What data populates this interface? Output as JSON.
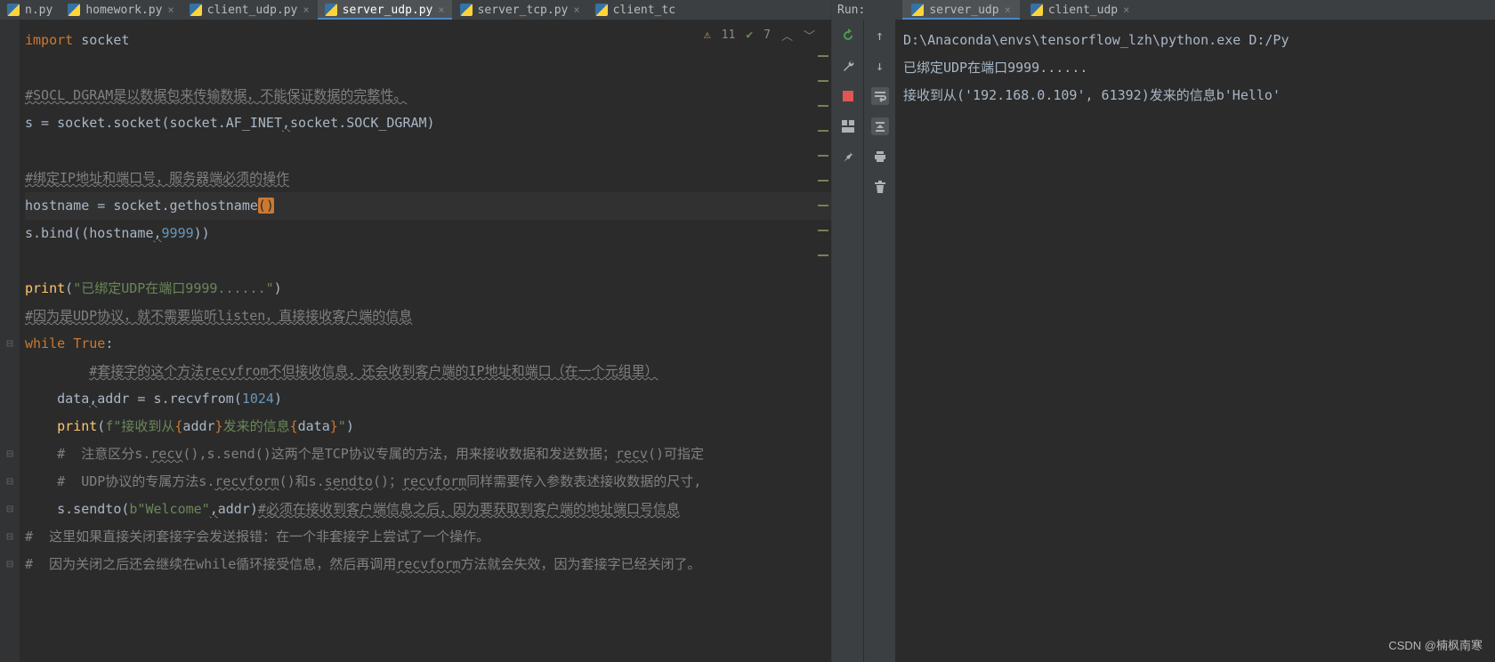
{
  "editor_tabs": [
    {
      "label": "n.py",
      "active": false,
      "partial": true
    },
    {
      "label": "homework.py",
      "active": false
    },
    {
      "label": "client_udp.py",
      "active": false
    },
    {
      "label": "server_udp.py",
      "active": true
    },
    {
      "label": "server_tcp.py",
      "active": false
    },
    {
      "label": "client_tc",
      "active": false,
      "partial": true
    }
  ],
  "status": {
    "warn_count": "11",
    "typo_count": "7"
  },
  "code_lines": [
    {
      "type": "plain",
      "tokens": [
        {
          "t": "import ",
          "c": "kw"
        },
        {
          "t": "socket",
          "c": ""
        }
      ]
    },
    {
      "type": "blank"
    },
    {
      "type": "cmt-wavy",
      "text": "#SOCL_DGRAM是以数据包来传输数据，不能保证数据的完整性。"
    },
    {
      "type": "plain",
      "tokens": [
        {
          "t": "s = socket.socket(socket.AF_INET",
          "c": ""
        },
        {
          "t": ",",
          "c": "wavy"
        },
        {
          "t": "socket.SOCK_DGRAM)",
          "c": ""
        }
      ]
    },
    {
      "type": "blank"
    },
    {
      "type": "cmt-wavy",
      "text": "#绑定IP地址和端口号，服务器端必须的操作"
    },
    {
      "type": "plain",
      "caret": true,
      "tokens": [
        {
          "t": "hostname = socket.gethostname",
          "c": ""
        },
        {
          "t": "()",
          "c": "fn-paren"
        }
      ]
    },
    {
      "type": "plain",
      "tokens": [
        {
          "t": "s.bind((hostname",
          "c": ""
        },
        {
          "t": ",",
          "c": "wavy"
        },
        {
          "t": "9999",
          "c": "num"
        },
        {
          "t": "))",
          "c": ""
        }
      ]
    },
    {
      "type": "blank"
    },
    {
      "type": "plain",
      "tokens": [
        {
          "t": "print",
          "c": "fn"
        },
        {
          "t": "(",
          "c": ""
        },
        {
          "t": "\"已绑定UDP在端口9999......\"",
          "c": "str"
        },
        {
          "t": ")",
          "c": ""
        }
      ]
    },
    {
      "type": "cmt-wavy",
      "text": "#因为是UDP协议，就不需要监听listen，直接接收客户端的信息"
    },
    {
      "type": "plain",
      "tokens": [
        {
          "t": "while ",
          "c": "kw"
        },
        {
          "t": "True",
          "c": "kw"
        },
        {
          "t": ":",
          "c": ""
        }
      ]
    },
    {
      "type": "cmt-wavy",
      "indent": 2,
      "text": "#套接字的这个方法recvfrom不但接收信息，还会收到客户端的IP地址和端口（在一个元组里）"
    },
    {
      "type": "plain",
      "indent": 1,
      "tokens": [
        {
          "t": "data",
          "c": ""
        },
        {
          "t": ",",
          "c": "wavy"
        },
        {
          "t": "addr = s.recvfrom(",
          "c": ""
        },
        {
          "t": "1024",
          "c": "num"
        },
        {
          "t": ")",
          "c": ""
        }
      ]
    },
    {
      "type": "plain",
      "indent": 1,
      "tokens": [
        {
          "t": "print",
          "c": "fn"
        },
        {
          "t": "(",
          "c": ""
        },
        {
          "t": "f\"",
          "c": "str"
        },
        {
          "t": "接收到从",
          "c": "str"
        },
        {
          "t": "{",
          "c": "kw"
        },
        {
          "t": "addr",
          "c": ""
        },
        {
          "t": "}",
          "c": "kw"
        },
        {
          "t": "发来的信息",
          "c": "str"
        },
        {
          "t": "{",
          "c": "kw"
        },
        {
          "t": "data",
          "c": ""
        },
        {
          "t": "}",
          "c": "kw"
        },
        {
          "t": "\"",
          "c": "str"
        },
        {
          "t": ")",
          "c": ""
        }
      ]
    },
    {
      "type": "cmt",
      "indent": 1,
      "tokens": [
        {
          "t": "#  注意区分s.",
          "c": "cmt"
        },
        {
          "t": "recv",
          "c": "cmt wavy"
        },
        {
          "t": "(),s.send()这两个是TCP协议专属的方法，用来接收数据和发送数据；",
          "c": "cmt"
        },
        {
          "t": "recv",
          "c": "cmt wavy"
        },
        {
          "t": "()可指定",
          "c": "cmt"
        }
      ]
    },
    {
      "type": "cmt",
      "indent": 1,
      "tokens": [
        {
          "t": "#  UDP协议的专属方法s.",
          "c": "cmt"
        },
        {
          "t": "recvform",
          "c": "cmt wavy"
        },
        {
          "t": "()和s.",
          "c": "cmt"
        },
        {
          "t": "sendto",
          "c": "cmt wavy"
        },
        {
          "t": "()；",
          "c": "cmt"
        },
        {
          "t": "recvform",
          "c": "cmt wavy"
        },
        {
          "t": "同样需要传入参数表述接收数据的尺寸,",
          "c": "cmt"
        }
      ]
    },
    {
      "type": "plain",
      "indent": 1,
      "tokens": [
        {
          "t": "s.sendto(",
          "c": ""
        },
        {
          "t": "b\"Welcome\"",
          "c": "str"
        },
        {
          "t": ",",
          "c": "wavy"
        },
        {
          "t": "addr)",
          "c": ""
        },
        {
          "t": "#必须在接收到客户端信息之后，因为要获取到客户端的地址端口号信息",
          "c": "cmt wavy"
        }
      ]
    },
    {
      "type": "cmt",
      "indent": 0,
      "tokens": [
        {
          "t": "#  这里如果直接关闭套接字会发送报错：在一个非套接字上尝试了一个操作。",
          "c": "cmt"
        }
      ]
    },
    {
      "type": "cmt",
      "indent": 0,
      "tokens": [
        {
          "t": "#  因为关闭之后还会继续在while循环接受信息，然后再调用",
          "c": "cmt"
        },
        {
          "t": "recvform",
          "c": "cmt wavy"
        },
        {
          "t": "方法就会失效，因为套接字已经关闭了。",
          "c": "cmt"
        }
      ]
    }
  ],
  "run": {
    "label": "Run:",
    "tabs": [
      {
        "label": "server_udp",
        "active": true
      },
      {
        "label": "client_udp",
        "active": false
      }
    ],
    "console_lines": [
      "D:\\Anaconda\\envs\\tensorflow_lzh\\python.exe D:/Py",
      "已绑定UDP在端口9999......",
      "接收到从('192.168.0.109', 61392)发来的信息b'Hello'"
    ]
  },
  "watermark": "CSDN @楠枫南寒"
}
